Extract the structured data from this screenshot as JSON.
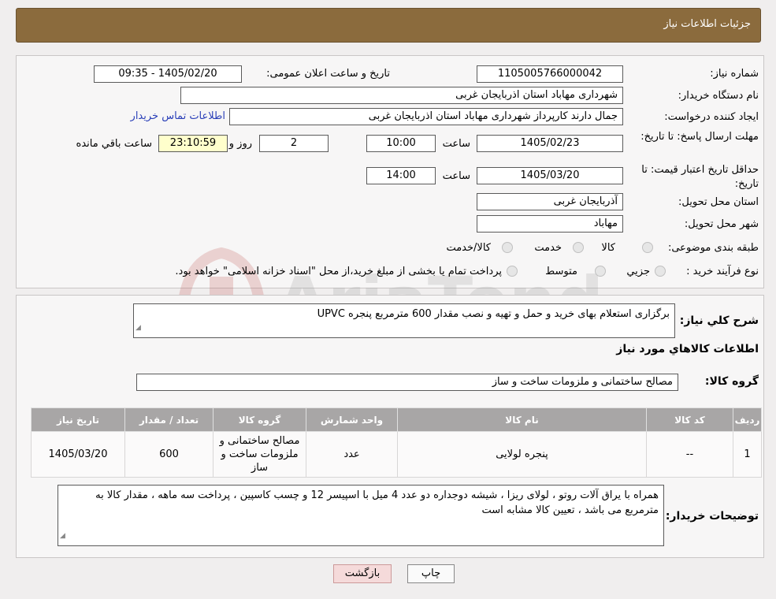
{
  "header": {
    "title": "جزئیات اطلاعات نیاز"
  },
  "labels": {
    "need_number": "شماره نیاز:",
    "announce_datetime": "تاریخ و ساعت اعلان عمومی:",
    "buyer_org": "نام دستگاه خریدار:",
    "requester": "ایجاد کننده درخواست:",
    "reply_deadline": "مهلت ارسال پاسخ: تا تاریخ:",
    "price_validity": "حداقل تاریخ اعتبار قیمت: تا تاریخ:",
    "time": "ساعت",
    "day_and": "روز و",
    "remaining": "ساعت باقي مانده",
    "province": "استان محل تحویل:",
    "city": "شهر محل تحویل:",
    "category": "طبقه بندی موضوعی:",
    "process_type": "نوع فرآیند خرید :",
    "description": "شرح کلي نیاز:",
    "goods_info": "اطلاعات کالاهاي مورد نياز",
    "goods_group": "گروه کالا:",
    "buyer_notes": "توضیحات خریدار:"
  },
  "values": {
    "need_number": "1105005766000042",
    "announce_datetime": "1405/02/20 - 09:35",
    "buyer_org": "شهرداری مهاباد استان اذربایجان غربی",
    "requester": "جمال دارند کارپرداز  شهرداری مهاباد استان اذربایجان غربی",
    "contact_link": "اطلاعات تماس خریدار",
    "reply_date": "1405/02/23",
    "reply_time": "10:00",
    "days": "2",
    "remaining_time": "23:10:59",
    "validity_date": "1405/03/20",
    "validity_time": "14:00",
    "province": "آذربایجان غربی",
    "city": "مهاباد",
    "description": "برگزاری استعلام بهای خرید و حمل و تهیه و نصب مقدار 600 مترمربع پنجره UPVC",
    "goods_group": "مصالح ساختمانی و ملزومات ساخت و ساز",
    "buyer_notes": "همراه با یراق آلات روتو ، لولای ریزا ، شیشه دوجداره دو عدد 4 میل با اسپیسر 12 و چسب کاسپین  ، پرداخت سه ماهه ، مقدار کالا به مترمربع می باشد ، تعیین کالا مشابه است"
  },
  "category_options": [
    "کالا",
    "خدمت",
    "کالا/خدمت"
  ],
  "process_options": [
    "جزیي",
    "متوسط"
  ],
  "process_note": "پرداخت تمام یا بخشی از مبلغ خرید،از محل \"اسناد خزانه اسلامی\" خواهد بود.",
  "table": {
    "headers": [
      "ردیف",
      "کد کالا",
      "نام کالا",
      "واحد شمارش",
      "گروه کالا",
      "تعداد / مقدار",
      "تاریخ نیاز"
    ],
    "rows": [
      [
        "1",
        "--",
        "پنجره لولایی",
        "عدد",
        "مصالح ساختمانی و ملزومات ساخت و ساز",
        "600",
        "1405/03/20"
      ]
    ]
  },
  "buttons": {
    "print": "چاپ",
    "back": "بازگشت"
  },
  "watermark": {
    "text": "AriaTender.neT"
  },
  "colors": {
    "header_bg": "#8b6b3d",
    "table_header_bg": "#a8a6a6",
    "link": "#2a3fb8",
    "remaining_bg": "#ffffcc"
  }
}
